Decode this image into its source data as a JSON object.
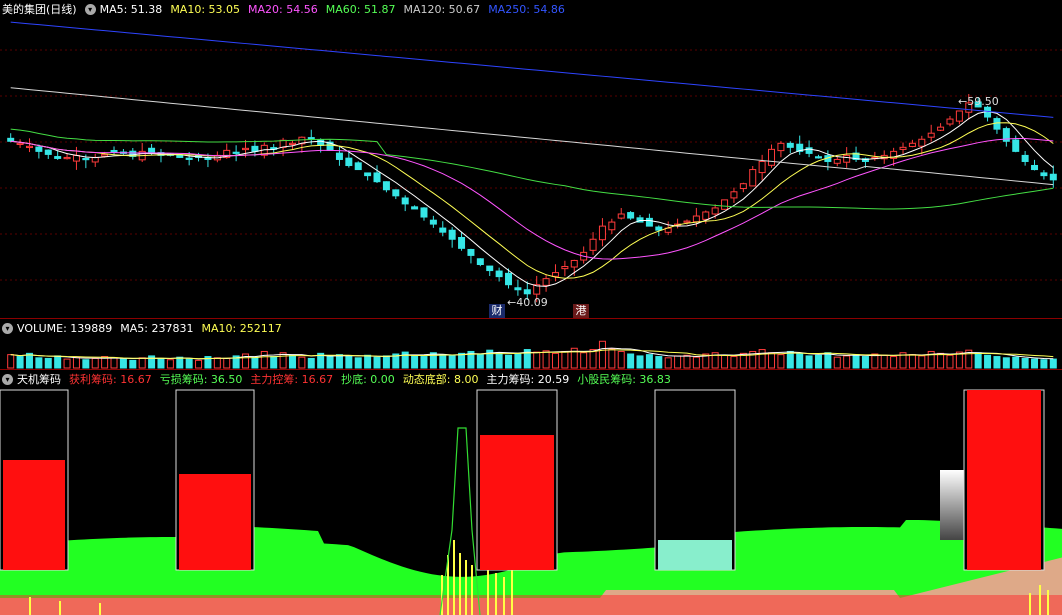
{
  "price_header": {
    "title": "美的集团(日线)",
    "ma": [
      {
        "label": "MA5: 51.38",
        "color": "#ffffff"
      },
      {
        "label": "MA10: 53.05",
        "color": "#ffff55"
      },
      {
        "label": "MA20: 54.56",
        "color": "#ff55ff"
      },
      {
        "label": "MA60: 51.87",
        "color": "#55ff55"
      },
      {
        "label": "MA120: 50.67",
        "color": "#cccccc"
      },
      {
        "label": "MA250: 54.86",
        "color": "#3355ff"
      }
    ]
  },
  "volume_header": {
    "items": [
      {
        "label": "VOLUME: 139889",
        "color": "#ffffff"
      },
      {
        "label": "MA5: 237831",
        "color": "#ffffff"
      },
      {
        "label": "MA10: 252117",
        "color": "#ffff55"
      }
    ]
  },
  "chip_header": {
    "items": [
      {
        "label": "天机筹码",
        "color": "#ffffff"
      },
      {
        "label": "获利筹码: 16.67",
        "color": "#ff3333"
      },
      {
        "label": "亏损筹码: 36.50",
        "color": "#55ff55"
      },
      {
        "label": "主力控筹: 16.67",
        "color": "#ff3333"
      },
      {
        "label": "抄底: 0.00",
        "color": "#55ff55"
      },
      {
        "label": "动态底部: 8.00",
        "color": "#ffff55"
      },
      {
        "label": "主力筹码: 20.59",
        "color": "#ffffff"
      },
      {
        "label": "小股民筹码: 36.83",
        "color": "#55ff55"
      }
    ]
  },
  "markers": {
    "high_label": "59.50",
    "low_label": "40.09",
    "event1": "财",
    "event2": "港"
  },
  "chart_data": [
    {
      "type": "candlestick",
      "ylim": [
        38,
        68
      ],
      "high_marker": 59.5,
      "low_marker": 40.09,
      "closes": [
        55.2,
        55.0,
        54.7,
        54.2,
        53.9,
        53.5,
        53.6,
        53.8,
        53.4,
        53.6,
        53.9,
        54.1,
        54.0,
        53.7,
        54.2,
        54.0,
        53.8,
        53.9,
        53.6,
        53.4,
        53.6,
        53.4,
        53.8,
        54.3,
        54.0,
        54.5,
        54.2,
        54.8,
        54.4,
        55.3,
        55.0,
        55.6,
        55.4,
        54.8,
        54.3,
        53.4,
        52.8,
        52.4,
        51.8,
        51.2,
        50.4,
        49.8,
        49.0,
        48.5,
        47.7,
        47.0,
        46.2,
        45.5,
        44.6,
        43.9,
        43.0,
        42.4,
        41.8,
        41.0,
        40.5,
        40.1,
        41.0,
        41.6,
        42.2,
        42.8,
        43.4,
        44.2,
        45.5,
        46.8,
        47.2,
        48.0,
        47.6,
        47.2,
        46.8,
        46.4,
        46.6,
        47.0,
        47.3,
        47.8,
        48.2,
        48.6,
        49.4,
        50.2,
        51.0,
        52.4,
        53.2,
        54.4,
        55.0,
        54.6,
        54.2,
        54.0,
        53.6,
        53.2,
        53.4,
        53.8,
        53.4,
        53.2,
        53.6,
        53.8,
        54.2,
        54.6,
        55.0,
        55.4,
        56.0,
        56.6,
        57.4,
        58.2,
        59.0,
        58.6,
        57.6,
        56.4,
        55.2,
        54.2,
        53.2,
        52.4,
        51.8,
        51.38
      ]
    },
    {
      "type": "bar",
      "name": "VOLUME",
      "values": [
        2.1,
        1.8,
        2.3,
        1.6,
        1.5,
        1.9,
        1.4,
        1.7,
        1.3,
        1.5,
        1.8,
        1.6,
        1.4,
        1.2,
        1.6,
        1.9,
        1.5,
        1.3,
        1.7,
        1.4,
        1.2,
        1.8,
        1.6,
        1.5,
        1.9,
        2.2,
        1.7,
        2.6,
        1.8,
        2.4,
        2.0,
        1.7,
        1.5,
        2.3,
        1.9,
        2.1,
        1.8,
        1.6,
        2.0,
        1.7,
        1.9,
        2.2,
        2.5,
        2.0,
        1.8,
        2.4,
        2.1,
        1.9,
        2.3,
        2.6,
        2.2,
        2.8,
        2.4,
        2.0,
        2.3,
        2.9,
        2.5,
        2.7,
        2.3,
        2.6,
        3.1,
        2.4,
        2.9,
        4.2,
        3.0,
        2.6,
        2.2,
        1.9,
        2.1,
        1.8,
        1.6,
        1.9,
        2.0,
        1.7,
        2.2,
        2.4,
        2.0,
        1.8,
        2.3,
        2.6,
        2.9,
        2.4,
        2.1,
        2.6,
        2.2,
        1.9,
        2.0,
        2.4,
        1.7,
        1.9,
        2.1,
        1.8,
        2.2,
        2.0,
        1.8,
        2.4,
        2.1,
        1.9,
        2.6,
        2.3,
        2.0,
        2.5,
        2.8,
        2.4,
        2.0,
        1.8,
        1.6,
        1.7,
        1.5,
        1.4,
        1.3,
        1.4
      ]
    }
  ]
}
